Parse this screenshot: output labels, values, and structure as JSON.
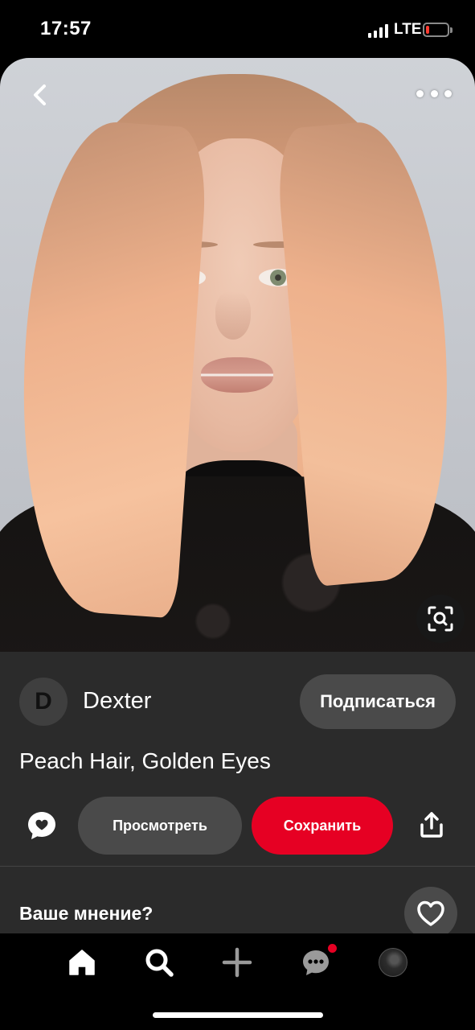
{
  "status_bar": {
    "time": "17:57",
    "network": "LTE",
    "battery_level": 0.15,
    "battery_color": "#ff3b30"
  },
  "pin": {
    "image_alt": "Woman with peach-colored shoulder-length hair wearing a black sheer top",
    "author_initial": "D",
    "author_name": "Dexter",
    "follow_label": "Подписаться",
    "title": "Peach Hair, Golden Eyes",
    "view_label": "Просмотреть",
    "save_label": "Сохранить",
    "feedback_prompt": "Ваше мнение?"
  },
  "nav": {
    "items": [
      "home-icon",
      "search-icon",
      "plus-icon",
      "messages-icon",
      "profile-avatar"
    ],
    "active": "search-icon",
    "notification_on": "messages-icon"
  },
  "colors": {
    "accent": "#e60023",
    "panel_bg": "#2b2b2b",
    "pill_bg": "#4a4a4a"
  }
}
